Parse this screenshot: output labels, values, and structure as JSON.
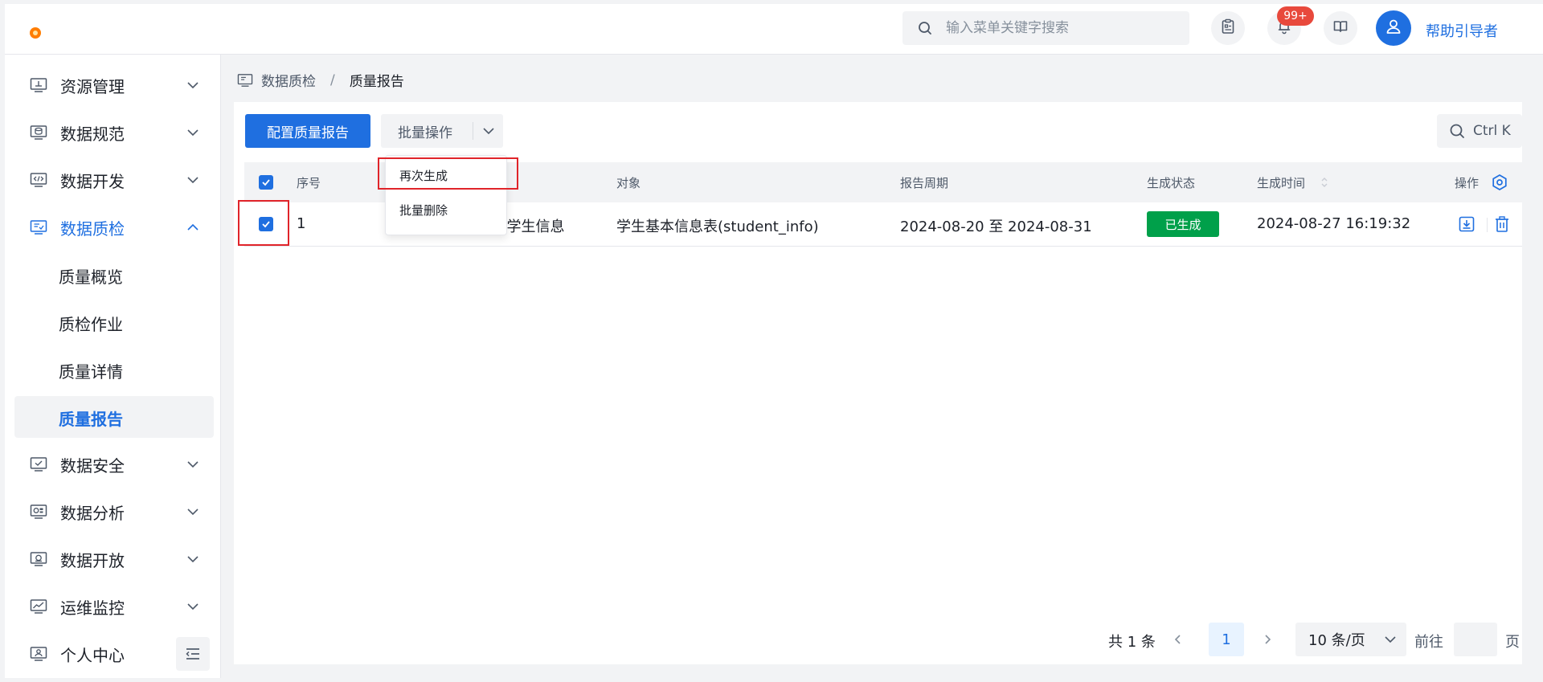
{
  "header": {
    "search_placeholder": "输入菜单关键字搜索",
    "notification_badge": "99+",
    "username": "帮助引导者"
  },
  "sidebar": {
    "items": [
      {
        "label": "资源管理",
        "icon": "monitor-icon"
      },
      {
        "label": "数据规范",
        "icon": "database-icon"
      },
      {
        "label": "数据开发",
        "icon": "code-icon"
      },
      {
        "label": "数据质检",
        "icon": "quality-icon"
      },
      {
        "label": "数据安全",
        "icon": "shield-check-icon"
      },
      {
        "label": "数据分析",
        "icon": "analysis-icon"
      },
      {
        "label": "数据开放",
        "icon": "open-icon"
      },
      {
        "label": "运维监控",
        "icon": "monitor-chart-icon"
      },
      {
        "label": "个人中心",
        "icon": "user-card-icon"
      }
    ],
    "sub_items": [
      {
        "label": "质量概览"
      },
      {
        "label": "质检作业"
      },
      {
        "label": "质量详情"
      },
      {
        "label": "质量报告"
      }
    ]
  },
  "breadcrumb": {
    "parent": "数据质检",
    "separator": "/",
    "current": "质量报告"
  },
  "toolbar": {
    "config_label": "配置质量报告",
    "batch_label": "批量操作",
    "search_label": "Ctrl K"
  },
  "dropdown": {
    "items": [
      {
        "label": "再次生成"
      },
      {
        "label": "批量删除"
      }
    ]
  },
  "table": {
    "columns": {
      "index": "序号",
      "object": "对象",
      "period": "报告周期",
      "status": "生成状态",
      "time": "生成时间",
      "ops": "操作"
    },
    "rows": [
      {
        "index": "1",
        "name": "-学生信息",
        "object": "学生基本信息表(student_info)",
        "period": "2024-08-20 至 2024-08-31",
        "status": "已生成",
        "time": "2024-08-27 16:19:32"
      }
    ]
  },
  "pagination": {
    "total": "共 1 条",
    "current": "1",
    "page_size": "10 条/页",
    "goto": "前往",
    "page": "页"
  },
  "colors": {
    "primary": "#1f6fe0",
    "success": "#00a04a",
    "badge": "#e8493c",
    "highlight": "#e0242a"
  }
}
